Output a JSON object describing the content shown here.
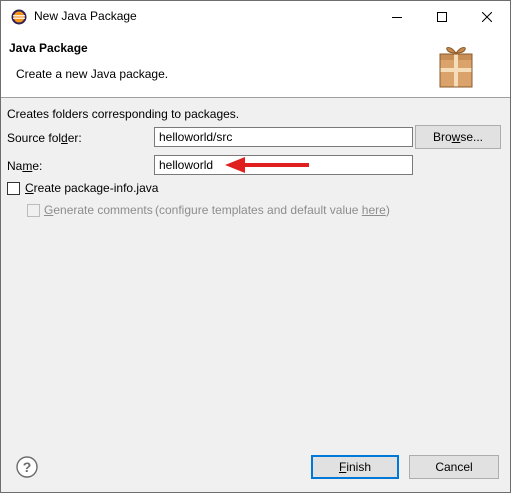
{
  "window": {
    "title": "New Java Package",
    "controls": {
      "minimize": "—",
      "maximize": "☐",
      "close": "✕"
    }
  },
  "banner": {
    "title": "Java Package",
    "description": "Create a new Java package."
  },
  "form": {
    "description": "Creates folders corresponding to packages.",
    "source_folder": {
      "label_pre": "Source fol",
      "label_mnemonic": "d",
      "label_post": "er:",
      "value": "helloworld/src",
      "browse_pre": "Bro",
      "browse_mnemonic": "w",
      "browse_post": "se..."
    },
    "name": {
      "label_pre": "Na",
      "label_mnemonic": "m",
      "label_post": "e:",
      "value": "helloworld"
    },
    "create_package_info": {
      "checked": false,
      "label_mnemonic": "C",
      "label_post": "reate package-info.java"
    },
    "generate_comments": {
      "checked": false,
      "enabled": false,
      "label_mnemonic": "G",
      "label_post": "enerate comments",
      "hint_pre": "(configure templates and default value ",
      "hint_link": "here",
      "hint_post": ")"
    }
  },
  "buttons": {
    "finish_mnemonic": "F",
    "finish_post": "inish",
    "cancel": "Cancel"
  },
  "colors": {
    "arrow": "#e0201e",
    "default_button_border": "#0078d7"
  },
  "icons": {
    "app": "eclipse-icon",
    "banner": "package-gift-icon",
    "help": "help-icon"
  }
}
